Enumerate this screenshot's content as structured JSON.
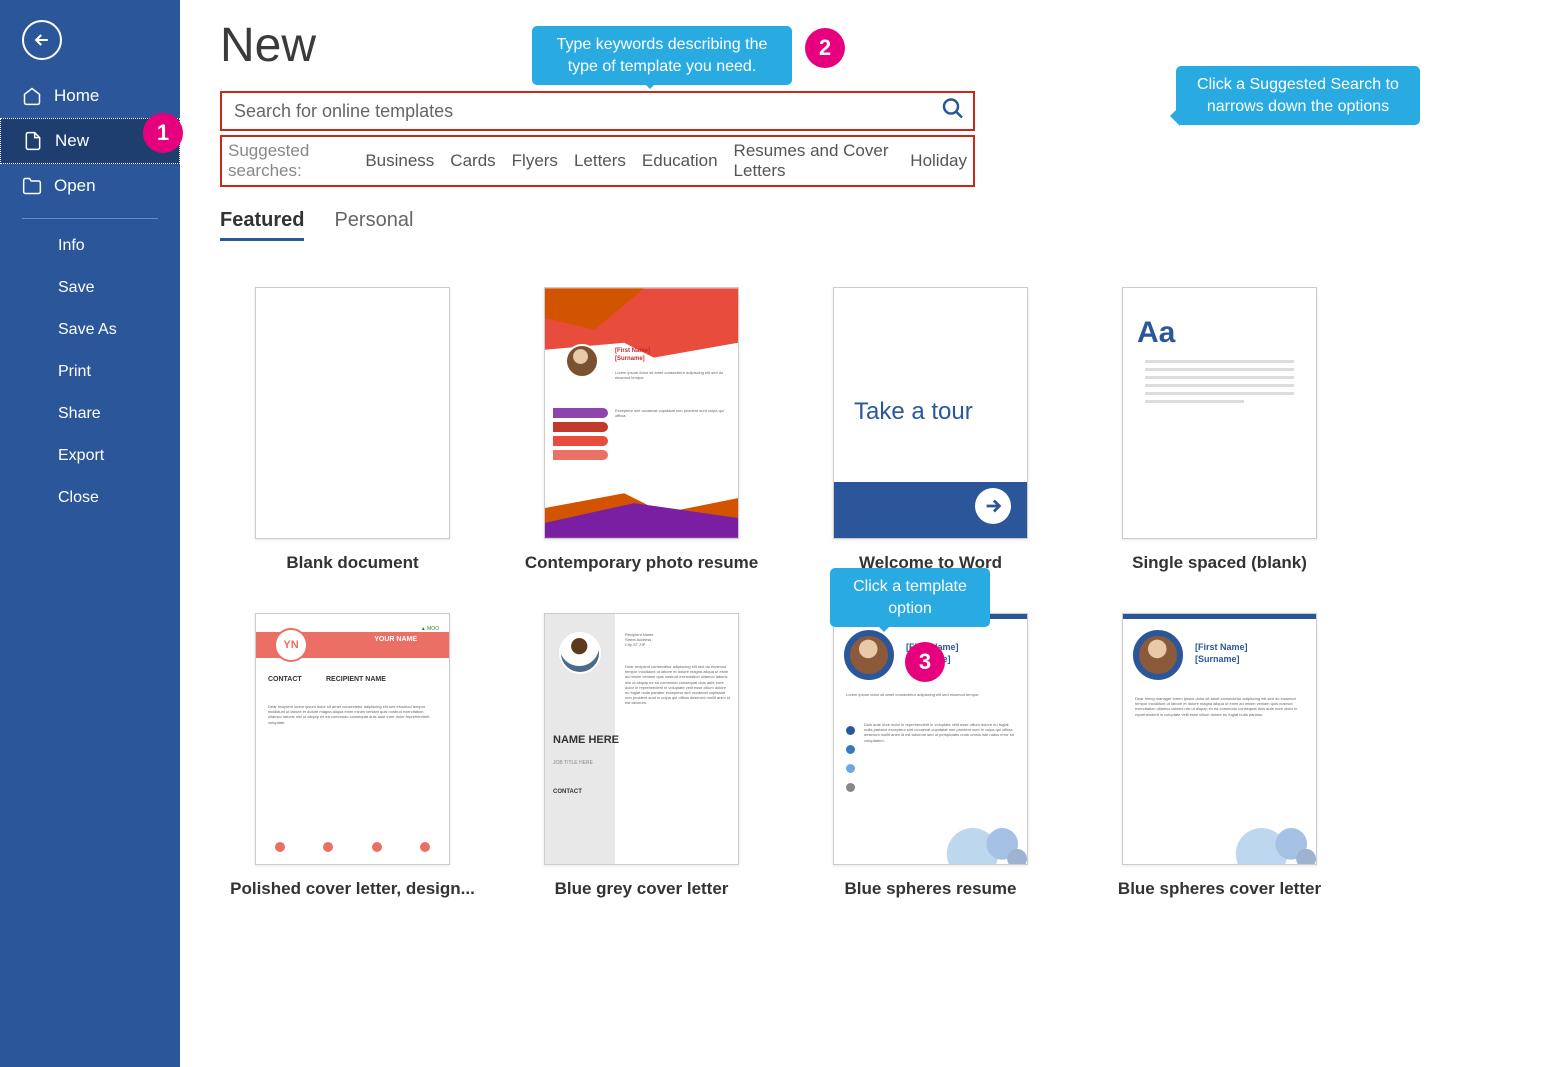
{
  "sidebar": {
    "nav": [
      {
        "label": "Home"
      },
      {
        "label": "New"
      },
      {
        "label": "Open"
      }
    ],
    "sub": [
      {
        "label": "Info"
      },
      {
        "label": "Save"
      },
      {
        "label": "Save As"
      },
      {
        "label": "Print"
      },
      {
        "label": "Share"
      },
      {
        "label": "Export"
      },
      {
        "label": "Close"
      }
    ]
  },
  "title": "New",
  "search": {
    "placeholder": "Search for online templates"
  },
  "suggested": {
    "label": "Suggested searches:",
    "items": [
      "Business",
      "Cards",
      "Flyers",
      "Letters",
      "Education",
      "Resumes and Cover Letters",
      "Holiday"
    ]
  },
  "tabs": [
    {
      "label": "Featured",
      "active": true
    },
    {
      "label": "Personal",
      "active": false
    }
  ],
  "templates": [
    {
      "label": "Blank document"
    },
    {
      "label": "Contemporary photo resume"
    },
    {
      "label": "Welcome to Word"
    },
    {
      "label": "Single spaced (blank)"
    },
    {
      "label": "Polished cover letter, design..."
    },
    {
      "label": "Blue grey cover letter"
    },
    {
      "label": "Blue spheres resume"
    },
    {
      "label": "Blue spheres cover letter"
    }
  ],
  "callouts": {
    "c1": "Type keywords describing the type of template you need.",
    "c2": "Click a Suggested Search to narrows down the options",
    "c3": "Click a template option"
  },
  "badges": {
    "b1": "1",
    "b2": "2",
    "b3": "3"
  },
  "thumb": {
    "tour": "Take a tour",
    "aa": "Aa",
    "firstname": "[First Name]",
    "surname": "[Surname]",
    "namehere": "NAME HERE",
    "jobtitle": "JOB TITLE HERE",
    "yn": "YN",
    "yourname": "YOUR NAME",
    "recipient": "RECIPIENT NAME",
    "contact": "CONTACT"
  }
}
